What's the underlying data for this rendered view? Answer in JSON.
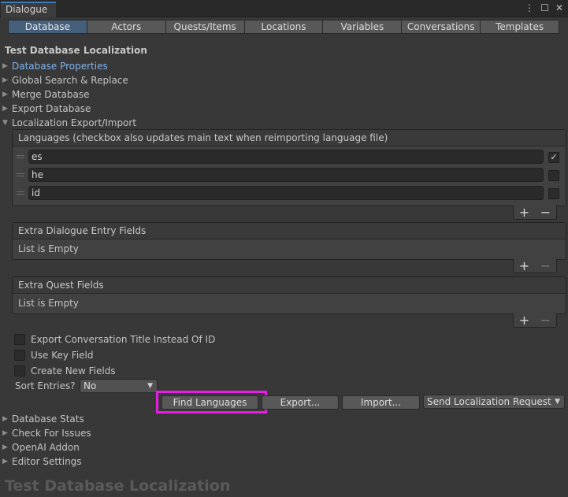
{
  "window": {
    "tab_title": "Dialogue",
    "menu_icon": "kebab-menu-icon",
    "maximize_icon": "maximize-icon",
    "close_icon": "close-icon"
  },
  "toolbar": {
    "tabs": [
      "Database",
      "Actors",
      "Quests/Items",
      "Locations",
      "Variables",
      "Conversations",
      "Templates"
    ],
    "active": "Database"
  },
  "database_title": "Test Database Localization",
  "foldouts_top": [
    {
      "label": "Database Properties",
      "expanded": false
    },
    {
      "label": "Global Search & Replace",
      "expanded": false
    },
    {
      "label": "Merge Database",
      "expanded": false
    },
    {
      "label": "Export Database",
      "expanded": false
    },
    {
      "label": "Localization Export/Import",
      "expanded": true
    }
  ],
  "languages": {
    "header": "Languages (checkbox also updates main text when reimporting language file)",
    "rows": [
      {
        "value": "es",
        "checked": true
      },
      {
        "value": "he",
        "checked": false
      },
      {
        "value": "id",
        "checked": false
      }
    ],
    "add_label": "+",
    "remove_label": "−"
  },
  "extra_dialogue_entry_fields": {
    "header": "Extra Dialogue Entry Fields",
    "empty_text": "List is Empty",
    "add_label": "+",
    "remove_label": "−"
  },
  "extra_quest_fields": {
    "header": "Extra Quest Fields",
    "empty_text": "List is Empty",
    "add_label": "+",
    "remove_label": "−"
  },
  "options": [
    {
      "label": "Export Conversation Title Instead Of ID",
      "checked": false
    },
    {
      "label": "Use Key Field",
      "checked": false
    },
    {
      "label": "Create New Fields",
      "checked": false
    }
  ],
  "sort_entries": {
    "label": "Sort Entries?",
    "value": "No"
  },
  "buttons": {
    "find_languages": "Find Languages",
    "export": "Export...",
    "import": "Import...",
    "send_request": "Send Localization Request"
  },
  "foldouts_bottom": [
    {
      "label": "Database Stats"
    },
    {
      "label": "Check For Issues"
    },
    {
      "label": "OpenAI Addon"
    },
    {
      "label": "Editor Settings"
    }
  ],
  "footer_title": "Test Database Localization",
  "colors": {
    "background": "#383838",
    "active_tab": "#46607c",
    "link": "#7fb3ef",
    "highlight": "#e61ee6"
  }
}
